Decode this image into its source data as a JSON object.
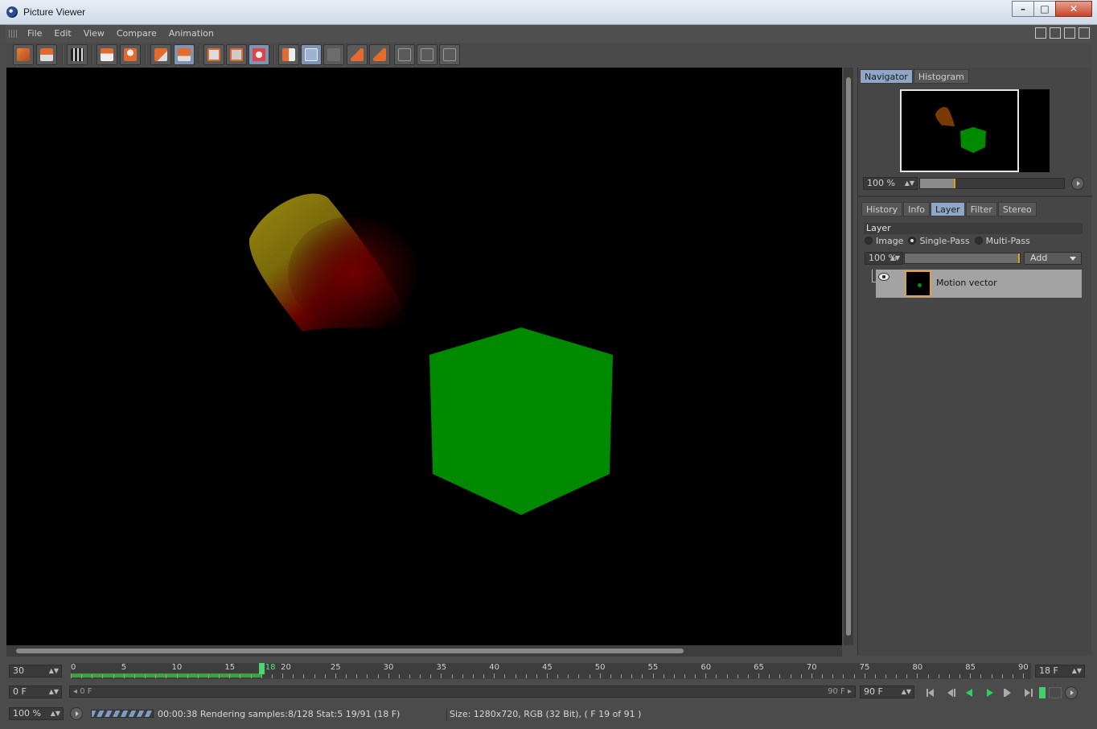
{
  "window": {
    "title": "Picture Viewer"
  },
  "menu": {
    "items": [
      "File",
      "Edit",
      "View",
      "Compare",
      "Animation"
    ]
  },
  "toolbar": {
    "buttons": [
      {
        "name": "open-icon"
      },
      {
        "name": "save-icon"
      },
      {
        "name": "render-queue-icon"
      },
      {
        "name": "filmstrip-icon"
      },
      {
        "name": "user-icon"
      },
      {
        "name": "copy-icon"
      },
      {
        "name": "layers-icon"
      },
      {
        "name": "view-a-icon"
      },
      {
        "name": "view-b-icon"
      },
      {
        "name": "compare-icon"
      },
      {
        "name": "ab-split-icon"
      },
      {
        "name": "ab-icon"
      },
      {
        "name": "ab-disabled-icon"
      },
      {
        "name": "set-a-icon"
      },
      {
        "name": "set-b-icon"
      },
      {
        "name": "grid-1-icon"
      },
      {
        "name": "grid-2-icon"
      },
      {
        "name": "grid-3-icon"
      }
    ]
  },
  "navigator": {
    "tabs": [
      "Navigator",
      "Histogram"
    ],
    "active_tab": "Navigator",
    "zoom": "100 %",
    "zoom_slider_value": 0.24
  },
  "layer_panel": {
    "tabs": [
      "History",
      "Info",
      "Layer",
      "Filter",
      "Stereo"
    ],
    "active_tab": "Layer",
    "group_title": "Layer",
    "modes": [
      "Image",
      "Single-Pass",
      "Multi-Pass"
    ],
    "selected_mode": "Single-Pass",
    "opacity": "100 %",
    "add_label": "Add",
    "layers": [
      {
        "name": "Motion vector",
        "visible": true
      }
    ]
  },
  "timeline": {
    "fps": "30",
    "current_frame_label": "18",
    "current_frame_field": "18 F",
    "start_frame": "0 F",
    "range_start": "0 F",
    "range_end": "90 F",
    "end_frame": "90 F",
    "ruler_labels": [
      "0",
      "5",
      "10",
      "15",
      "20",
      "25",
      "30",
      "35",
      "40",
      "45",
      "50",
      "55",
      "60",
      "65",
      "70",
      "75",
      "80",
      "85",
      "90"
    ],
    "current_frame": 18,
    "max_frame": 90
  },
  "status": {
    "zoom": "100 %",
    "render_info": "00:00:38 Rendering samples:8/128 Stat:5 19/91 (18 F)",
    "image_info": "Size: 1280x720, RGB (32 Bit),  ( F 19 of 91 )"
  },
  "colors": {
    "accent": "#8fa6c9",
    "cube_green": "#008a00",
    "timeline_green": "#3ea33e",
    "cursor_green": "#4ed46e"
  }
}
